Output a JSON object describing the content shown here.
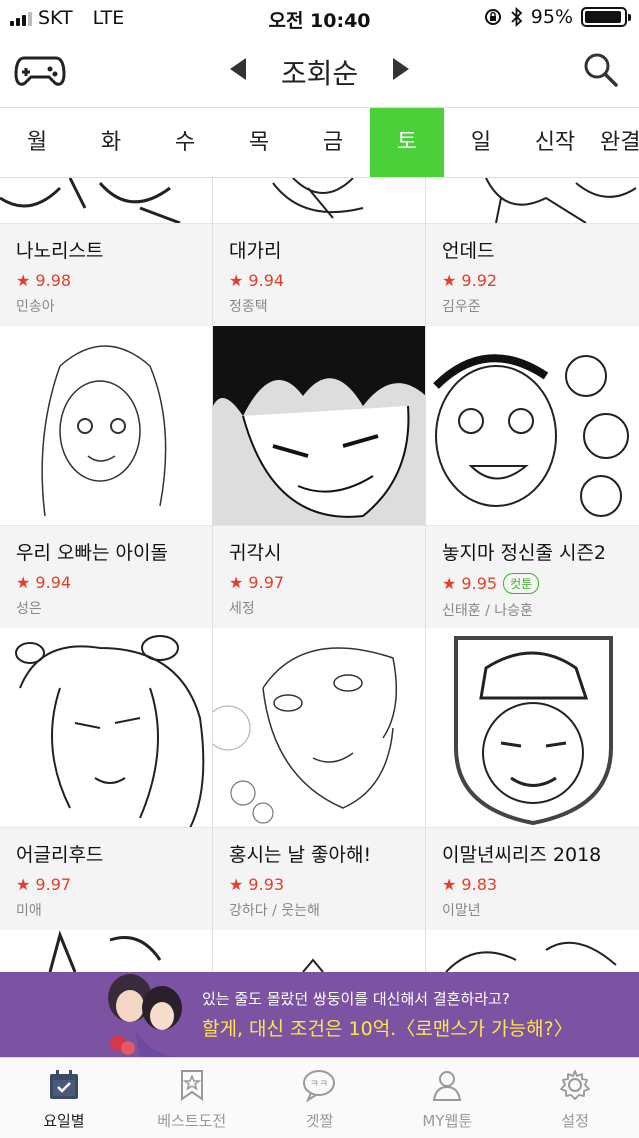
{
  "status": {
    "carrier": "SKT",
    "network": "LTE",
    "time": "오전 10:40",
    "battery": "95%",
    "battery_level": 0.95
  },
  "header": {
    "sort_label": "조회순"
  },
  "tabs": [
    {
      "label": "월"
    },
    {
      "label": "화"
    },
    {
      "label": "수"
    },
    {
      "label": "목"
    },
    {
      "label": "금"
    },
    {
      "label": "토",
      "active": true
    },
    {
      "label": "일"
    },
    {
      "label": "신작"
    },
    {
      "label": "완결"
    }
  ],
  "comics": [
    {
      "title": "나노리스트",
      "rating": "★ 9.98",
      "author": "민송아"
    },
    {
      "title": "대가리",
      "rating": "★ 9.94",
      "author": "정종택"
    },
    {
      "title": "언데드",
      "rating": "★ 9.92",
      "author": "김우준"
    },
    {
      "title": "우리 오빠는 아이돌",
      "rating": "★ 9.94",
      "author": "성은"
    },
    {
      "title": "귀각시",
      "rating": "★ 9.97",
      "author": "세정"
    },
    {
      "title": "놓지마 정신줄 시즌2",
      "rating": "★ 9.95",
      "badge": "컷툰",
      "author": "신태훈 / 나승훈"
    },
    {
      "title": "어글리후드",
      "rating": "★ 9.97",
      "author": "미애"
    },
    {
      "title": "홍시는 날 좋아해!",
      "rating": "★ 9.93",
      "author": "강하다 / 웃는해"
    },
    {
      "title": "이말년씨리즈 2018",
      "rating": "★ 9.83",
      "author": "이말년"
    }
  ],
  "banner": {
    "line1": "있는 줄도 몰랐던 쌍둥이를 대신해서 결혼하라고?",
    "line2": "할게, 대신 조건은 10억.〈로맨스가 가능해?〉"
  },
  "nav": [
    {
      "label": "요일별",
      "icon": "calendar-icon",
      "active": true
    },
    {
      "label": "베스트도전",
      "icon": "bookmark-star-icon"
    },
    {
      "label": "겟짤",
      "icon": "chat-bubble-icon"
    },
    {
      "label": "MY웹툰",
      "icon": "person-icon"
    },
    {
      "label": "설정",
      "icon": "gear-icon"
    }
  ]
}
